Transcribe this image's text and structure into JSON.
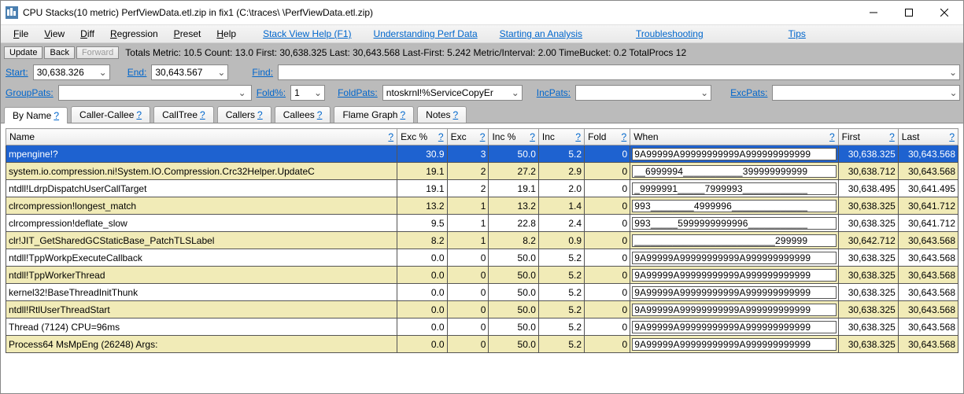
{
  "window": {
    "title": "CPU Stacks(10 metric) PerfViewData.etl.zip in fix1 (C:\\traces\\                                   \\PerfViewData.etl.zip)"
  },
  "menu": {
    "file": "File",
    "view": "View",
    "diff": "Diff",
    "regression": "Regression",
    "preset": "Preset",
    "help": "Help",
    "links": {
      "stackviewhelp": "Stack View Help (F1)",
      "understanding": "Understanding Perf Data",
      "starting": "Starting an Analysis",
      "troubleshooting": "Troubleshooting",
      "tips": "Tips"
    }
  },
  "toolbar": {
    "update": "Update",
    "back": "Back",
    "forward": "Forward",
    "stats": "Totals Metric: 10.5  Count: 13.0  First: 30,638.325 Last: 30,643.568  Last-First: 5.242  Metric/Interval: 2.00  TimeBucket: 0.2  TotalProcs 12"
  },
  "filters": {
    "start_label": "Start:",
    "start_value": "30,638.326",
    "end_label": "End:",
    "end_value": "30,643.567",
    "find_label": "Find:",
    "grouppats_label": "GroupPats:",
    "grouppats_value": "",
    "foldpct_label": "Fold%:",
    "foldpct_value": "1",
    "foldpats_label": "FoldPats:",
    "foldpats_value": "ntoskrnl!%ServiceCopyEr",
    "incpats_label": "IncPats:",
    "incpats_value": "",
    "excpats_label": "ExcPats:",
    "excpats_value": ""
  },
  "tabs": [
    {
      "label": "By Name",
      "q": "?",
      "active": true
    },
    {
      "label": "Caller-Callee",
      "q": "?"
    },
    {
      "label": "CallTree",
      "q": "?"
    },
    {
      "label": "Callers",
      "q": "?"
    },
    {
      "label": "Callees",
      "q": "?"
    },
    {
      "label": "Flame Graph",
      "q": "?"
    },
    {
      "label": "Notes",
      "q": "?"
    }
  ],
  "columns": {
    "name": "Name",
    "excp": "Exc %",
    "exc": "Exc",
    "incp": "Inc %",
    "inc": "Inc",
    "fold": "Fold",
    "when": "When",
    "first": "First",
    "last": "Last",
    "q": "?"
  },
  "rows": [
    {
      "sel": true,
      "hl": false,
      "name": "mpengine!?",
      "excp": "30.9",
      "exc": "3",
      "incp": "50.0",
      "inc": "5.2",
      "fold": "0",
      "when": "9A99999A99999999999A999999999999",
      "first": "30,638.325",
      "last": "30,643.568"
    },
    {
      "hl": true,
      "name": "system.io.compression.ni!System.IO.Compression.Crc32Helper.UpdateC",
      "excp": "19.1",
      "exc": "2",
      "incp": "27.2",
      "inc": "2.9",
      "fold": "0",
      "when": "__6999994___________399999999999",
      "first": "30,638.712",
      "last": "30,643.568"
    },
    {
      "hl": false,
      "name": "ntdll!LdrpDispatchUserCallTarget",
      "excp": "19.1",
      "exc": "2",
      "incp": "19.1",
      "inc": "2.0",
      "fold": "0",
      "when": "_9999991_____7999993____________",
      "first": "30,638.495",
      "last": "30,641.495"
    },
    {
      "hl": true,
      "name": "clrcompression!longest_match",
      "excp": "13.2",
      "exc": "1",
      "incp": "13.2",
      "inc": "1.4",
      "fold": "0",
      "when": "993________4999996______________",
      "first": "30,638.325",
      "last": "30,641.712"
    },
    {
      "hl": false,
      "name": "clrcompression!deflate_slow",
      "excp": "9.5",
      "exc": "1",
      "incp": "22.8",
      "inc": "2.4",
      "fold": "0",
      "when": "993_____5999999999996___________",
      "first": "30,638.325",
      "last": "30,641.712"
    },
    {
      "hl": true,
      "name": "clr!JIT_GetSharedGCStaticBase_PatchTLSLabel",
      "excp": "8.2",
      "exc": "1",
      "incp": "8.2",
      "inc": "0.9",
      "fold": "0",
      "when": "__________________________299999",
      "first": "30,642.712",
      "last": "30,643.568"
    },
    {
      "hl": false,
      "name": "ntdll!TppWorkpExecuteCallback",
      "excp": "0.0",
      "exc": "0",
      "incp": "50.0",
      "inc": "5.2",
      "fold": "0",
      "when": "9A99999A99999999999A999999999999",
      "first": "30,638.325",
      "last": "30,643.568"
    },
    {
      "hl": true,
      "name": "ntdll!TppWorkerThread",
      "excp": "0.0",
      "exc": "0",
      "incp": "50.0",
      "inc": "5.2",
      "fold": "0",
      "when": "9A99999A99999999999A999999999999",
      "first": "30,638.325",
      "last": "30,643.568"
    },
    {
      "hl": false,
      "name": "kernel32!BaseThreadInitThunk",
      "excp": "0.0",
      "exc": "0",
      "incp": "50.0",
      "inc": "5.2",
      "fold": "0",
      "when": "9A99999A99999999999A999999999999",
      "first": "30,638.325",
      "last": "30,643.568"
    },
    {
      "hl": true,
      "name": "ntdll!RtlUserThreadStart",
      "excp": "0.0",
      "exc": "0",
      "incp": "50.0",
      "inc": "5.2",
      "fold": "0",
      "when": "9A99999A99999999999A999999999999",
      "first": "30,638.325",
      "last": "30,643.568"
    },
    {
      "hl": false,
      "name": "Thread (7124) CPU=96ms",
      "excp": "0.0",
      "exc": "0",
      "incp": "50.0",
      "inc": "5.2",
      "fold": "0",
      "when": "9A99999A99999999999A999999999999",
      "first": "30,638.325",
      "last": "30,643.568"
    },
    {
      "hl": true,
      "name": "Process64 MsMpEng (26248) Args:",
      "excp": "0.0",
      "exc": "0",
      "incp": "50.0",
      "inc": "5.2",
      "fold": "0",
      "when": "9A99999A99999999999A999999999999",
      "first": "30,638.325",
      "last": "30,643.568"
    }
  ]
}
